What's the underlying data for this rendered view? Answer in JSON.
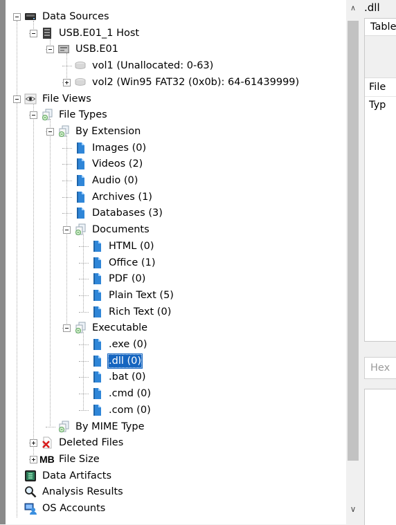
{
  "tree": {
    "nodes": [
      {
        "id": "data-sources",
        "label": "Data Sources",
        "level": 0,
        "toggle": "minus",
        "icon": "drive-icon",
        "selected": false
      },
      {
        "id": "usb-host",
        "label": "USB.E01_1 Host",
        "level": 1,
        "toggle": "minus",
        "icon": "server-icon",
        "selected": false
      },
      {
        "id": "usb-e01",
        "label": "USB.E01",
        "level": 2,
        "toggle": "minus",
        "icon": "disk-image-icon",
        "selected": false
      },
      {
        "id": "vol1",
        "label": "vol1 (Unallocated: 0-63)",
        "level": 3,
        "toggle": "none",
        "icon": "volume-icon",
        "selected": false
      },
      {
        "id": "vol2",
        "label": "vol2 (Win95 FAT32 (0x0b): 64-61439999)",
        "level": 3,
        "toggle": "plus",
        "icon": "volume-icon",
        "selected": false
      },
      {
        "id": "file-views",
        "label": "File Views",
        "level": 0,
        "toggle": "minus",
        "icon": "eye-icon",
        "selected": false
      },
      {
        "id": "file-types",
        "label": "File Types",
        "level": 1,
        "toggle": "minus",
        "icon": "file-filter-icon",
        "selected": false
      },
      {
        "id": "by-extension",
        "label": "By Extension",
        "level": 2,
        "toggle": "minus",
        "icon": "file-filter-icon",
        "selected": false
      },
      {
        "id": "images",
        "label": "Images (0)",
        "level": 3,
        "toggle": "none",
        "icon": "file-icon",
        "selected": false
      },
      {
        "id": "videos",
        "label": "Videos (2)",
        "level": 3,
        "toggle": "none",
        "icon": "file-icon",
        "selected": false
      },
      {
        "id": "audio",
        "label": "Audio (0)",
        "level": 3,
        "toggle": "none",
        "icon": "file-icon",
        "selected": false
      },
      {
        "id": "archives",
        "label": "Archives (1)",
        "level": 3,
        "toggle": "none",
        "icon": "file-icon",
        "selected": false
      },
      {
        "id": "databases",
        "label": "Databases (3)",
        "level": 3,
        "toggle": "none",
        "icon": "file-icon",
        "selected": false
      },
      {
        "id": "documents",
        "label": "Documents",
        "level": 3,
        "toggle": "minus",
        "icon": "file-filter-icon",
        "selected": false
      },
      {
        "id": "html",
        "label": "HTML (0)",
        "level": 4,
        "toggle": "none",
        "icon": "file-icon",
        "selected": false
      },
      {
        "id": "office",
        "label": "Office (1)",
        "level": 4,
        "toggle": "none",
        "icon": "file-icon",
        "selected": false
      },
      {
        "id": "pdf",
        "label": "PDF (0)",
        "level": 4,
        "toggle": "none",
        "icon": "file-icon",
        "selected": false
      },
      {
        "id": "plain-text",
        "label": "Plain Text (5)",
        "level": 4,
        "toggle": "none",
        "icon": "file-icon",
        "selected": false
      },
      {
        "id": "rich-text",
        "label": "Rich Text (0)",
        "level": 4,
        "toggle": "none",
        "icon": "file-icon",
        "selected": false
      },
      {
        "id": "executable",
        "label": "Executable",
        "level": 3,
        "toggle": "minus",
        "icon": "file-filter-icon",
        "selected": false
      },
      {
        "id": "exe",
        "label": ".exe (0)",
        "level": 4,
        "toggle": "none",
        "icon": "file-icon",
        "selected": false
      },
      {
        "id": "dll",
        "label": ".dll (0)",
        "level": 4,
        "toggle": "none",
        "icon": "file-icon",
        "selected": true
      },
      {
        "id": "bat",
        "label": ".bat (0)",
        "level": 4,
        "toggle": "none",
        "icon": "file-icon",
        "selected": false
      },
      {
        "id": "cmd",
        "label": ".cmd (0)",
        "level": 4,
        "toggle": "none",
        "icon": "file-icon",
        "selected": false
      },
      {
        "id": "com",
        "label": ".com (0)",
        "level": 4,
        "toggle": "none",
        "icon": "file-icon",
        "selected": false
      },
      {
        "id": "by-mime-type",
        "label": "By MIME Type",
        "level": 2,
        "toggle": "none",
        "icon": "file-filter-icon",
        "selected": false
      },
      {
        "id": "deleted-files",
        "label": "Deleted Files",
        "level": 1,
        "toggle": "plus",
        "icon": "deleted-file-icon",
        "selected": false
      },
      {
        "id": "file-size",
        "label": "File Size",
        "level": 1,
        "toggle": "plus",
        "icon": "mb-icon",
        "icon_text": "MB",
        "selected": false
      },
      {
        "id": "data-artifacts",
        "label": "Data Artifacts",
        "level": 0,
        "toggle": "none",
        "icon": "artifacts-icon",
        "selected": false
      },
      {
        "id": "analysis-results",
        "label": "Analysis Results",
        "level": 0,
        "toggle": "none",
        "icon": "magnifier-icon",
        "selected": false
      },
      {
        "id": "os-accounts",
        "label": "OS Accounts",
        "level": 0,
        "toggle": "none",
        "icon": "accounts-icon",
        "selected": false
      }
    ]
  },
  "right_panel": {
    "title": ".dll",
    "tab_table": "Table",
    "column_file_type": "File Typ",
    "tab_hex": "Hex"
  },
  "colors": {
    "selection": "#1565c0",
    "file_icon_blue": "#2f86d8",
    "tree_background": "#ffffff",
    "panel_background": "#f0f0f0"
  }
}
